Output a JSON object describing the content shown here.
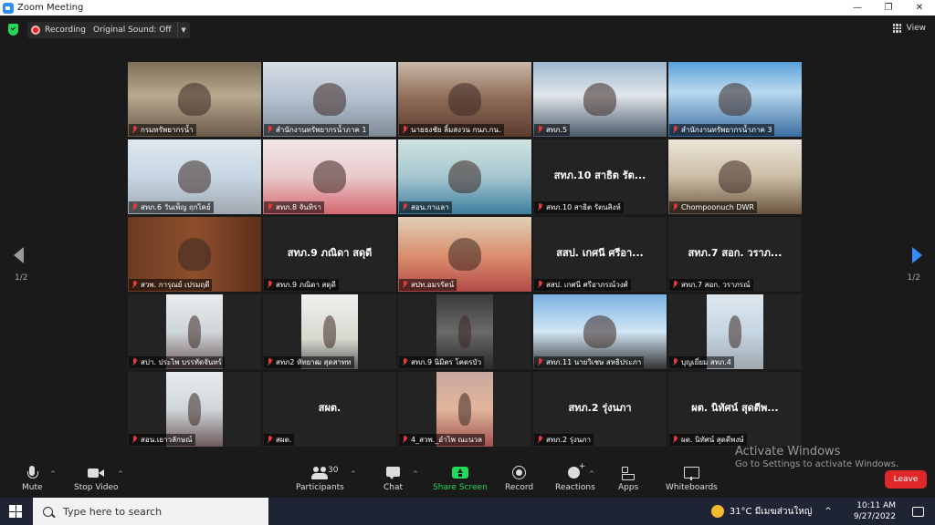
{
  "window": {
    "title": "Zoom Meeting",
    "controls": [
      "—",
      "❐",
      "✕"
    ]
  },
  "topbar": {
    "recording_label": "Recording",
    "original_sound_label": "Original Sound: Off",
    "view_label": "View"
  },
  "participants_grid": [
    {
      "name": "กรมทรัพยากรน้ำ",
      "bigname": "",
      "video": "v-office",
      "active": true,
      "pin": true
    },
    {
      "name": "สำนักงานทรัพยากรน้ำภาค 1",
      "bigname": "",
      "video": "v-meeting"
    },
    {
      "name": "นายธงชัย ลิ้มสงวน กนภ.กน.",
      "bigname": "",
      "video": "v-face"
    },
    {
      "name": "สทภ.5",
      "bigname": "",
      "video": "v-room"
    },
    {
      "name": "สำนักงานทรัพยากรน้ำภาค 3",
      "bigname": "",
      "video": "v-blue"
    },
    {
      "name": "สทภ.6 วันเพ็ญ ฤกไคย์",
      "bigname": "",
      "video": "v-light"
    },
    {
      "name": "สทภ.8 จันทิรา",
      "bigname": "",
      "video": "v-pink"
    },
    {
      "name": "สอน.กาแลา",
      "bigname": "",
      "video": "v-teal"
    },
    {
      "name": "สทภ.10 สาธิต รัตนสิงห์",
      "bigname": "สทภ.10 สาธิต  รัต...",
      "video": ""
    },
    {
      "name": "Chompoonuch DWR",
      "bigname": "",
      "video": "v-sketch"
    },
    {
      "name": "สวพ. การุณย์ เปรมฤดี",
      "bigname": "",
      "video": "v-wood"
    },
    {
      "name": "สทภ.9 ภณิดา สดุดี",
      "bigname": "สทภ.9 ภณิดา สดุดี",
      "video": ""
    },
    {
      "name": "สปท.อมรรัตน์",
      "bigname": "",
      "video": "v-orange"
    },
    {
      "name": "สสป. เกศนี ศรีอาภรณ์วงศ์",
      "bigname": "สสป. เกศนี ศรีอา...",
      "video": ""
    },
    {
      "name": "สทภ.7 สอก. วราภรณ์",
      "bigname": "สทภ.7 สอก. วราภ...",
      "video": ""
    },
    {
      "name": "สปา. ประไพ  บรรทัดจันทร์",
      "bigname": "",
      "video": "v-cream",
      "narrow": true
    },
    {
      "name": "สทภ2 หัทยาฒ สุดสาทท",
      "bigname": "",
      "video": "v-white",
      "narrow": true
    },
    {
      "name": "สทภ.9 นิมิตร โคตรบัว",
      "bigname": "",
      "video": "v-dark",
      "narrow": true
    },
    {
      "name": "สทภ.11 นายวิเชษ สหธิประภา",
      "bigname": "",
      "video": "v-sky"
    },
    {
      "name": "บุญเยี่ยม สทภ.4",
      "bigname": "",
      "video": "v-light",
      "narrow": true
    },
    {
      "name": "สอน.เยาวลักษณ์",
      "bigname": "",
      "video": "v-cream",
      "narrow": true
    },
    {
      "name": "สผต.",
      "bigname": "สผต.",
      "video": ""
    },
    {
      "name": "4_สวพ._อำไพ ณะนวล",
      "bigname": "",
      "video": "v-warm",
      "narrow": true
    },
    {
      "name": "สทภ.2 รุ่งนภา",
      "bigname": "สทภ.2 รุ่งนภา",
      "video": ""
    },
    {
      "name": "ผต. นิทัศน์ สุดตีพงษ์",
      "bigname": "ผต. นิทัศน์ สุดตีพ...",
      "video": ""
    }
  ],
  "pagination": {
    "left": "1/2",
    "right": "1/2"
  },
  "toolbar": {
    "mute": "Mute",
    "stop_video": "Stop Video",
    "participants": "Participants",
    "participants_count": "30",
    "chat": "Chat",
    "share_screen": "Share Screen",
    "record": "Record",
    "reactions": "Reactions",
    "apps": "Apps",
    "whiteboards": "Whiteboards",
    "leave": "Leave"
  },
  "watermark": {
    "line1": "Activate Windows",
    "line2": "Go to Settings to activate Windows."
  },
  "taskbar": {
    "search_placeholder": "Type here to search",
    "weather": "31°C  มีเมฆส่วนใหญ่",
    "time": "10:11 AM",
    "date": "9/27/2022"
  },
  "colors": {
    "accent": "#2d8cff",
    "share_green": "#23d959",
    "leave_red": "#e02828",
    "active_border": "#e6e060"
  }
}
